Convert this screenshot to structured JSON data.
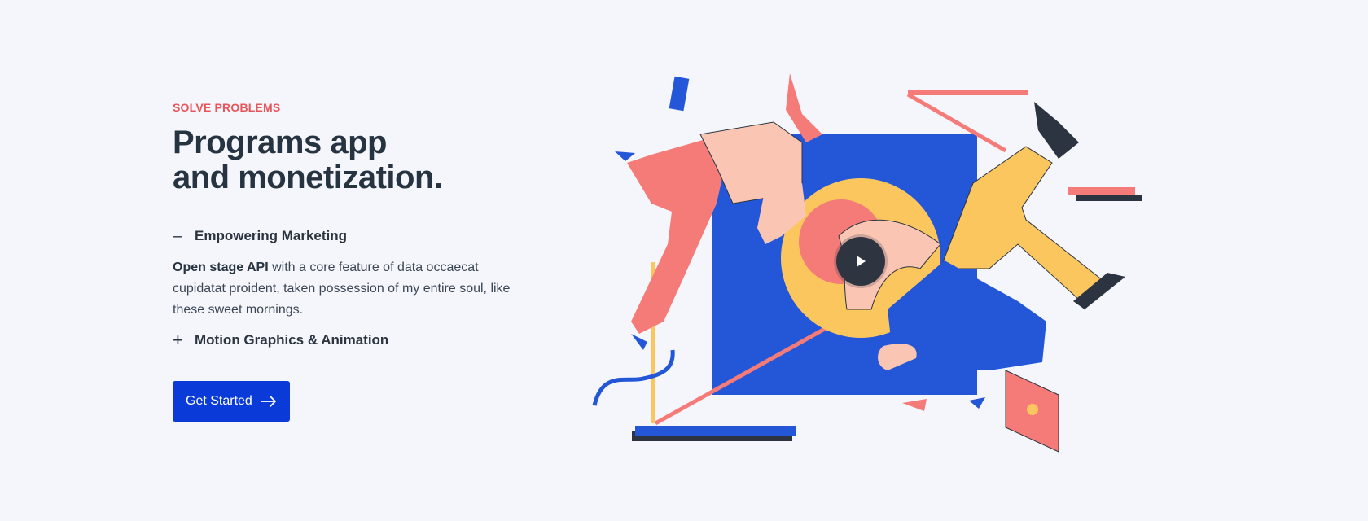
{
  "hero": {
    "eyebrow": "SOLVE PROBLEMS",
    "title_line1": "Programs app",
    "title_line2": "and monetization.",
    "accordion": [
      {
        "sign": "–",
        "label": "Empowering Marketing",
        "expanded": true,
        "body_bold": "Open stage API",
        "body_text": " with a core feature of data occaecat cupidatat proident, taken possession of my entire soul, like these sweet mornings."
      },
      {
        "sign": "+",
        "label": "Motion Graphics & Animation",
        "expanded": false
      }
    ],
    "cta_label": "Get Started",
    "cta_icon": "arrow-right-icon"
  },
  "illustration": {
    "play_icon": "play-icon",
    "colors": {
      "blue": "#2357d8",
      "yellow": "#fcc65f",
      "coral": "#f57b78",
      "peach": "#fbc5b4",
      "dark": "#2b3440"
    }
  }
}
